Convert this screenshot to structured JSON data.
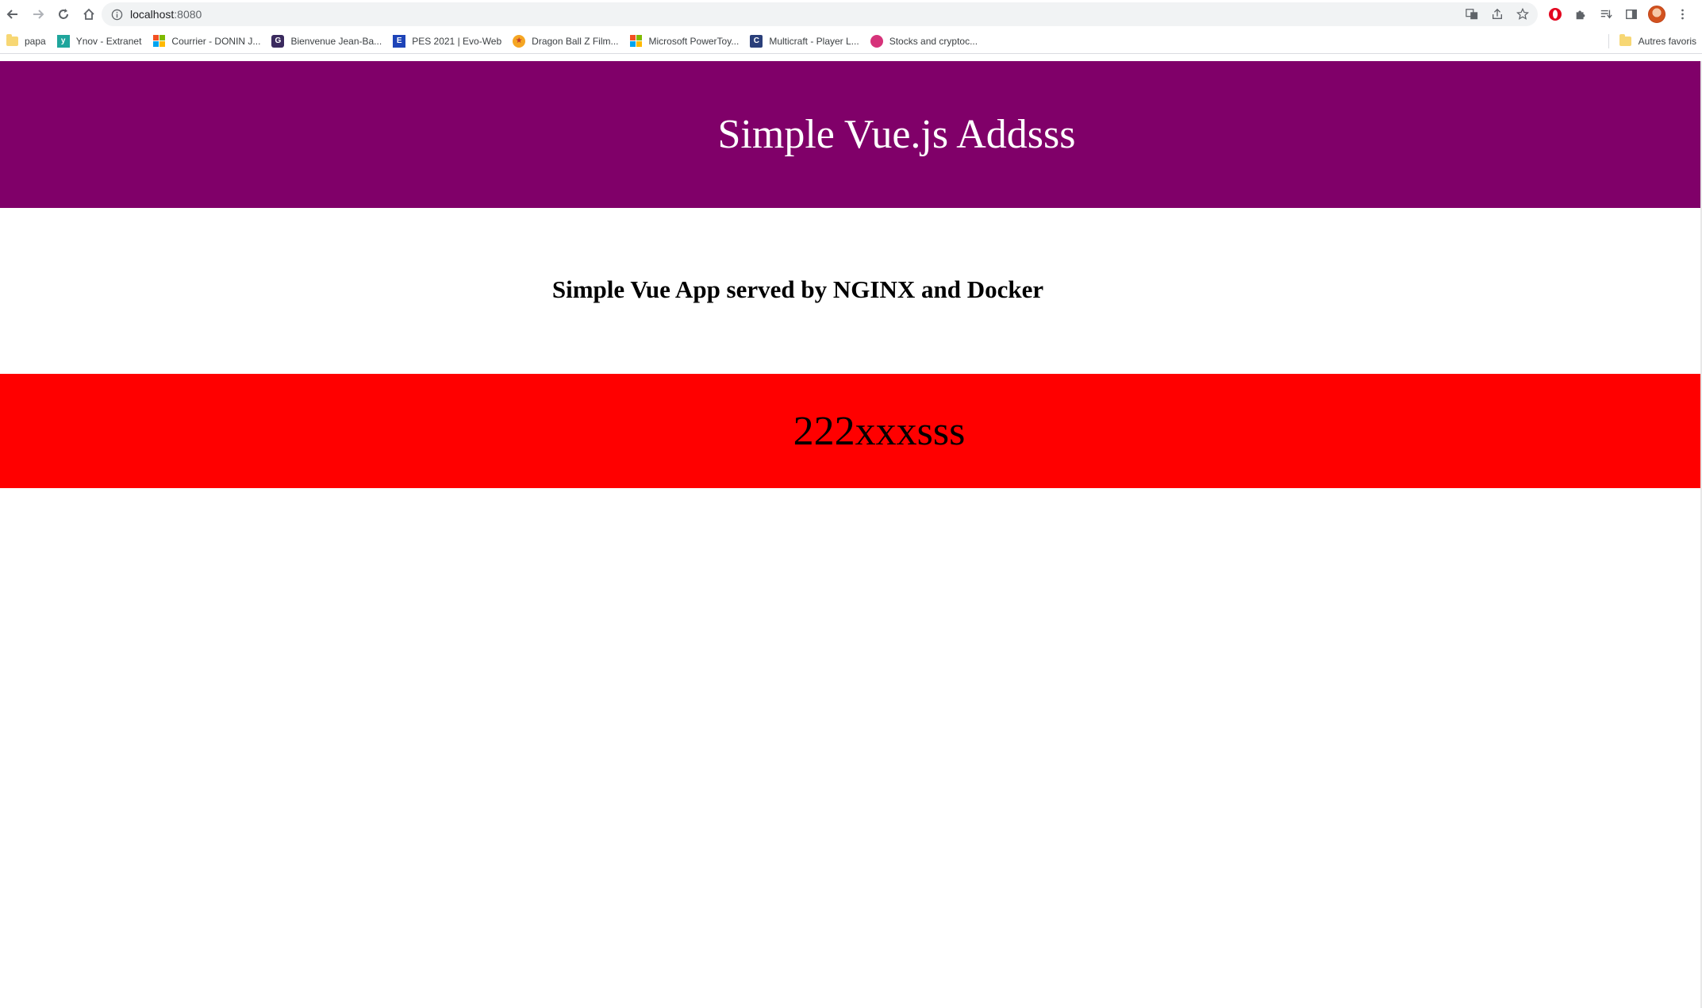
{
  "browser": {
    "url_host": "localhost",
    "url_port": ":8080",
    "bookmarks": [
      {
        "label": "papa",
        "icon": "folder-icon"
      },
      {
        "label": "Ynov - Extranet",
        "icon": "ynov-icon"
      },
      {
        "label": "Courrier - DONIN J...",
        "icon": "microsoft-icon"
      },
      {
        "label": "Bienvenue Jean-Ba...",
        "icon": "g-icon"
      },
      {
        "label": "PES 2021 | Evo-Web",
        "icon": "evo-icon"
      },
      {
        "label": "Dragon Ball Z Film...",
        "icon": "dragonball-icon"
      },
      {
        "label": "Microsoft PowerToy...",
        "icon": "microsoft-icon"
      },
      {
        "label": "Multicraft - Player L...",
        "icon": "multicraft-icon"
      },
      {
        "label": "Stocks and cryptoc...",
        "icon": "stocks-icon"
      }
    ],
    "other_bookmarks": "Autres favoris"
  },
  "page": {
    "header_title": "Simple Vue.js Addsss",
    "subtitle": "Simple Vue App served by NGINX and Docker",
    "red_value": "222xxxsss"
  },
  "colors": {
    "header_bg": "#800069",
    "red_bar_bg": "#ff0000"
  }
}
